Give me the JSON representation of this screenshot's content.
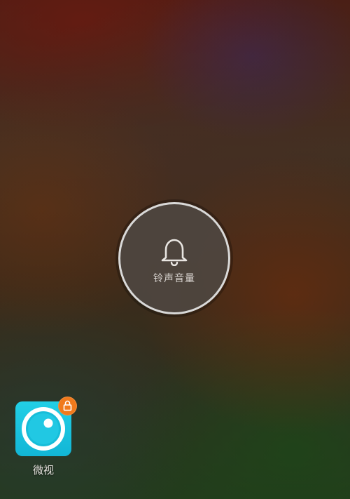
{
  "volume_hud": {
    "icon": "bell-icon",
    "label": "铃声音量"
  },
  "app": {
    "label": "微视",
    "icon": "weishi-app-icon",
    "badge_icon": "lock-icon",
    "tile_color": "#1cc4de",
    "badge_color": "#f07a1c"
  }
}
